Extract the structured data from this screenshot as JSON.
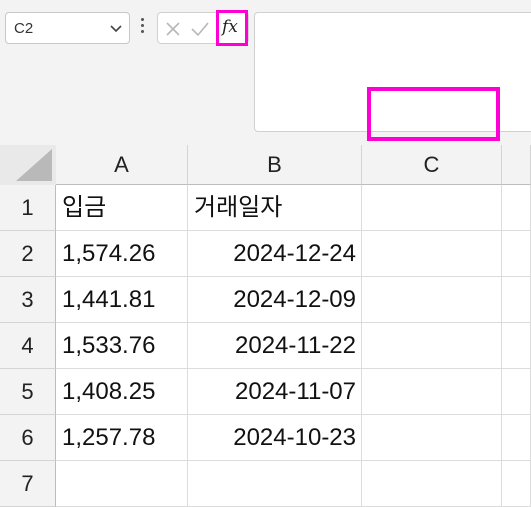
{
  "name_box": {
    "value": "C2"
  },
  "formula_bar": {
    "fx_label": "fx",
    "value": ""
  },
  "colors": {
    "highlight": "#ff00d4",
    "header_bg": "#f3f3f3"
  },
  "columns": [
    "A",
    "B",
    "C"
  ],
  "rows": [
    {
      "num": "1",
      "cells": [
        "입금",
        "거래일자",
        ""
      ]
    },
    {
      "num": "2",
      "cells": [
        "1,574.26",
        "2024-12-24",
        ""
      ]
    },
    {
      "num": "3",
      "cells": [
        "1,441.81",
        "2024-12-09",
        ""
      ]
    },
    {
      "num": "4",
      "cells": [
        "1,533.76",
        "2024-11-22",
        ""
      ]
    },
    {
      "num": "5",
      "cells": [
        "1,408.25",
        "2024-11-07",
        ""
      ]
    },
    {
      "num": "6",
      "cells": [
        "1,257.78",
        "2024-10-23",
        ""
      ]
    },
    {
      "num": "7",
      "cells": [
        "",
        "",
        ""
      ]
    }
  ],
  "selected_cell": "C2"
}
